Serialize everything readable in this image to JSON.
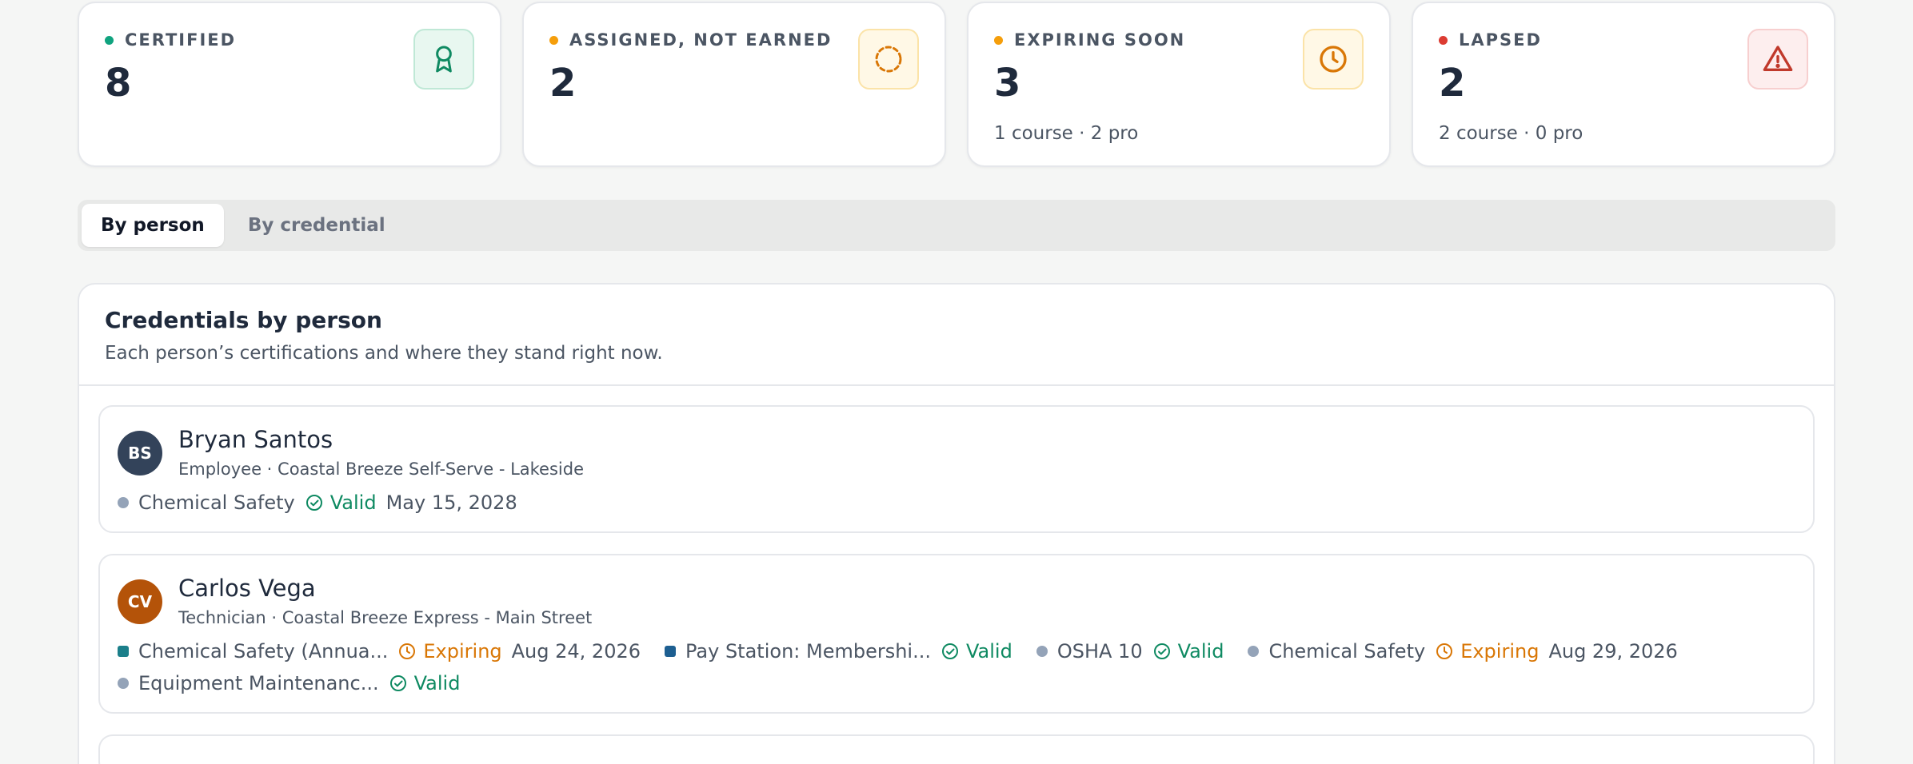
{
  "stats": [
    {
      "label": "CERTIFIED",
      "value": "8",
      "sub": "",
      "dot": "#10a37f",
      "icon": "ribbon-icon",
      "icon_color": "#0f8a62",
      "icon_bg": "#e8f7f0",
      "icon_border": "#bfe8d6"
    },
    {
      "label": "ASSIGNED, NOT EARNED",
      "value": "2",
      "sub": "",
      "dot": "#f59e0b",
      "icon": "dashed-circle-icon",
      "icon_color": "#d97706",
      "icon_bg": "#fff8e6",
      "icon_border": "#fbe3a8"
    },
    {
      "label": "EXPIRING SOON",
      "value": "3",
      "sub": "1 course · 2 pro",
      "dot": "#f59e0b",
      "icon": "clock-icon",
      "icon_color": "#d97706",
      "icon_bg": "#fff8e6",
      "icon_border": "#fbe3a8"
    },
    {
      "label": "LAPSED",
      "value": "2",
      "sub": "2 course · 0 pro",
      "dot": "#dc3c32",
      "icon": "warning-icon",
      "icon_color": "#c0392b",
      "icon_bg": "#fdeeee",
      "icon_border": "#f7cfcf"
    }
  ],
  "tabs": [
    {
      "label": "By person",
      "active": true
    },
    {
      "label": "By credential",
      "active": false
    }
  ],
  "panel": {
    "title": "Credentials by person",
    "subtitle": "Each person’s certifications and where they stand right now."
  },
  "people": [
    {
      "initials": "BS",
      "avatar_color": "#33435a",
      "name": "Bryan Santos",
      "meta": "Employee · Coastal Breeze Self-Serve - Lakeside",
      "credentials": [
        {
          "name": "Chemical Safety",
          "marker": "circle",
          "marker_color": "#94a3b8",
          "status": "Valid",
          "status_type": "valid",
          "date": "May 15, 2028"
        }
      ]
    },
    {
      "initials": "CV",
      "avatar_color": "#b45309",
      "name": "Carlos Vega",
      "meta": "Technician · Coastal Breeze Express - Main Street",
      "credentials": [
        {
          "name": "Chemical Safety (Annua...",
          "marker": "square",
          "marker_color": "#1b7f8a",
          "status": "Expiring",
          "status_type": "expiring",
          "date": "Aug 24, 2026"
        },
        {
          "name": "Pay Station: Membershi...",
          "marker": "square",
          "marker_color": "#1d5f91",
          "status": "Valid",
          "status_type": "valid",
          "date": ""
        },
        {
          "name": "OSHA 10",
          "marker": "circle",
          "marker_color": "#94a3b8",
          "status": "Valid",
          "status_type": "valid",
          "date": ""
        },
        {
          "name": "Chemical Safety",
          "marker": "circle",
          "marker_color": "#94a3b8",
          "status": "Expiring",
          "status_type": "expiring",
          "date": "Aug 29, 2026"
        },
        {
          "name": "Equipment Maintenanc...",
          "marker": "circle",
          "marker_color": "#94a3b8",
          "status": "Valid",
          "status_type": "valid",
          "date": ""
        }
      ]
    }
  ]
}
